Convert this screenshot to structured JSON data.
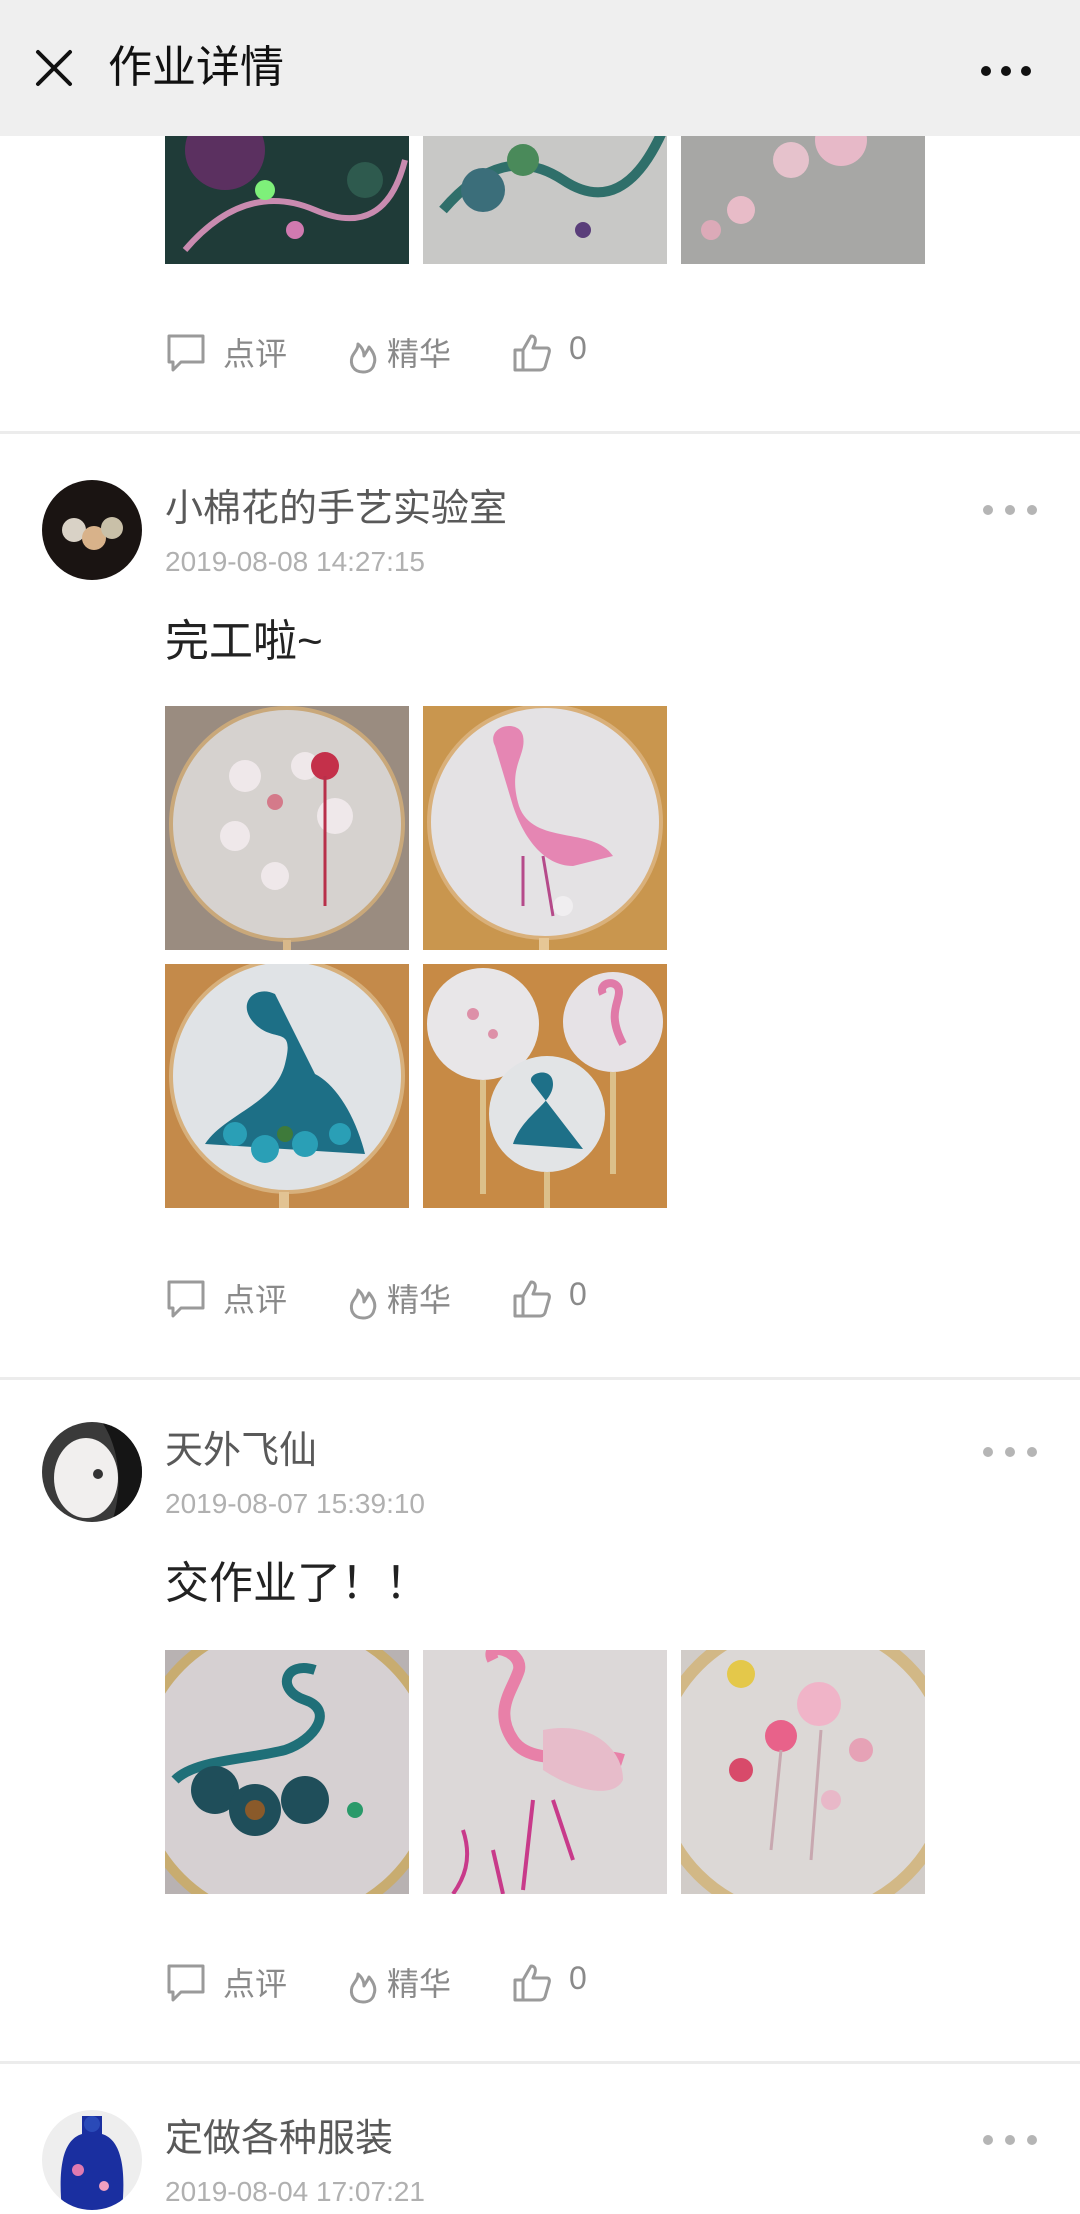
{
  "header": {
    "title": "作业详情",
    "close_icon": "close-icon",
    "more_icon": "more-icon"
  },
  "actions": {
    "comment": "点评",
    "essence": "精华"
  },
  "posts": [
    {
      "likes": "0"
    },
    {
      "user": "小棉花的手艺实验室",
      "time": "2019-08-08 14:27:15",
      "text": "完工啦~",
      "likes": "0"
    },
    {
      "user": "天外飞仙",
      "time": "2019-08-07 15:39:10",
      "text": "交作业了！！",
      "likes": "0"
    },
    {
      "user": "定做各种服装",
      "time": "2019-08-04 17:07:21"
    }
  ]
}
